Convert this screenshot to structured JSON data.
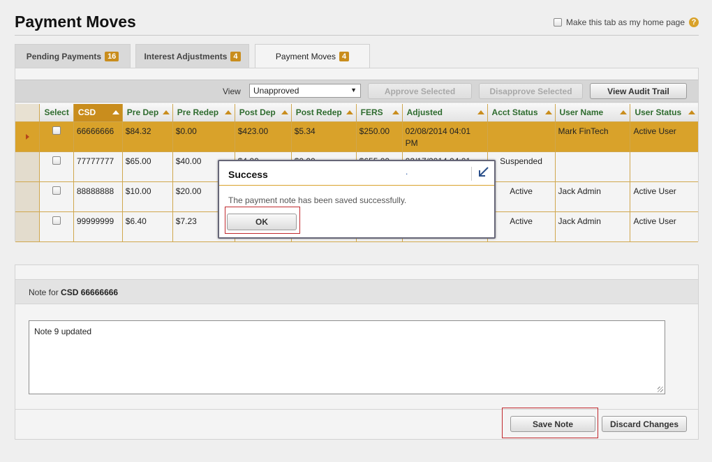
{
  "page": {
    "title": "Payment Moves"
  },
  "home_option": {
    "label": "Make this tab as my home page",
    "checked": false,
    "help_icon": "question-mark-icon"
  },
  "tabs": [
    {
      "label": "Pending Payments",
      "count": "16",
      "active": false
    },
    {
      "label": "Interest Adjustments",
      "count": "4",
      "active": false
    },
    {
      "label": "Payment Moves",
      "count": "4",
      "active": true
    }
  ],
  "toolbar": {
    "view_label": "View",
    "view_value": "Unapproved",
    "approve_label": "Approve Selected",
    "disapprove_label": "Disapprove Selected",
    "audit_label": "View Audit Trail"
  },
  "grid": {
    "columns": [
      "Select",
      "CSD",
      "Pre Dep",
      "Pre Redep",
      "Post Dep",
      "Post Redep",
      "FERS",
      "Adjusted",
      "Acct Status",
      "User Name",
      "User Status"
    ],
    "sorted_column": "CSD",
    "rows": [
      {
        "csd": "66666666",
        "pre_dep": "$84.32",
        "pre_redep": "$0.00",
        "post_dep": "$423.00",
        "post_redep": "$5.34",
        "fers": "$250.00",
        "adjusted": "02/08/2014 04:01 PM",
        "acct_status": "",
        "user_name": "Mark FinTech",
        "user_status": "Active User",
        "selected": true
      },
      {
        "csd": "77777777",
        "pre_dep": "$65.00",
        "pre_redep": "$40.00",
        "post_dep": "$4.00",
        "post_redep": "$0.00",
        "fers": "$655.00",
        "adjusted": "02/17/2014 04:01",
        "acct_status": "Suspended",
        "user_name": "",
        "user_status": "",
        "selected": false
      },
      {
        "csd": "88888888",
        "pre_dep": "$10.00",
        "pre_redep": "$20.00",
        "post_dep": "",
        "post_redep": "",
        "fers": "",
        "adjusted": "",
        "acct_status": "Active",
        "user_name": "Jack Admin",
        "user_status": "Active User",
        "selected": false
      },
      {
        "csd": "99999999",
        "pre_dep": "$6.40",
        "pre_redep": "$7.23",
        "post_dep": "",
        "post_redep": "",
        "fers": "",
        "adjusted": "",
        "acct_status": "Active",
        "user_name": "Jack Admin",
        "user_status": "Active User",
        "selected": false
      }
    ]
  },
  "note": {
    "header_prefix": "Note for",
    "header_csd": "CSD 66666666",
    "text": "Note 9 updated",
    "save_label": "Save Note",
    "discard_label": "Discard Changes"
  },
  "modal": {
    "title": "Success",
    "dot": ".",
    "message": "The payment note has been saved successfully.",
    "ok_label": "OK",
    "collapse_icon": "collapse-arrow-icon"
  },
  "colors": {
    "accent": "#d9a22a",
    "badge": "#c98d1d",
    "header_text": "#2e6b2e",
    "highlight_outline": "#c0282d"
  }
}
